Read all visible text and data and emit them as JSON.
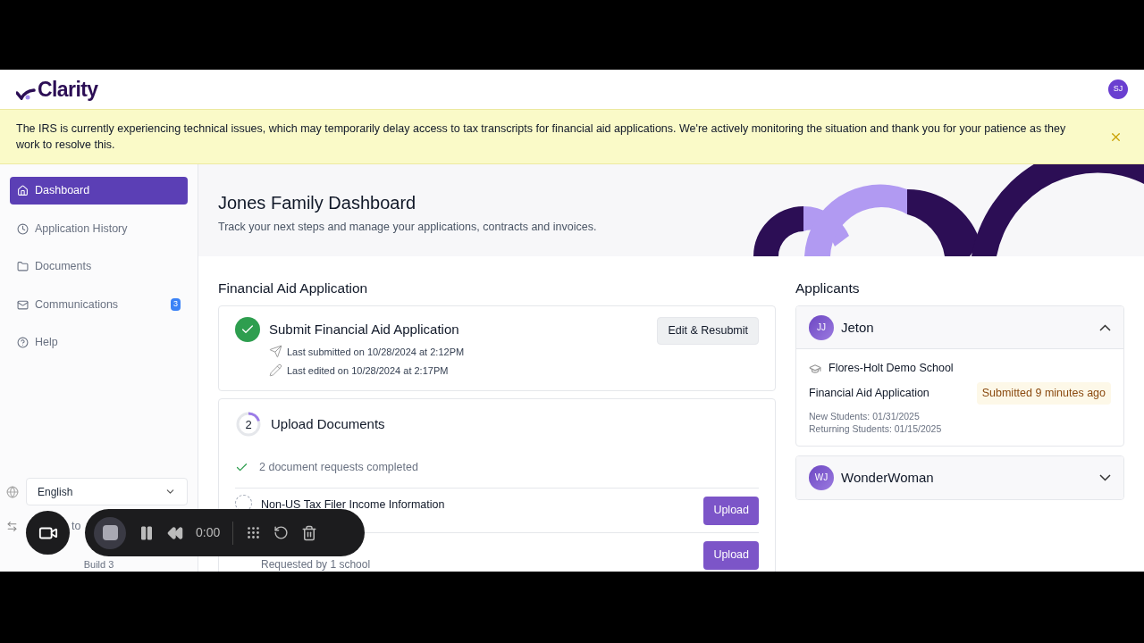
{
  "logo": {
    "text": "Clarity"
  },
  "user": {
    "initials": "SJ"
  },
  "banner": {
    "message": "The IRS is currently experiencing technical issues, which may temporarily delay access to tax transcripts for financial aid applications. We're actively monitoring the situation and thank you for your patience as they work to resolve this."
  },
  "sidebar": {
    "items": [
      {
        "label": "Dashboard",
        "selected": true
      },
      {
        "label": "Application History",
        "selected": false
      },
      {
        "label": "Documents",
        "selected": false
      },
      {
        "label": "Communications",
        "selected": false,
        "badge": "3"
      },
      {
        "label": "Help",
        "selected": false
      }
    ],
    "language": "English",
    "switch_link": "to",
    "build": "Build 3"
  },
  "hero": {
    "title": "Jones Family Dashboard",
    "subtitle": "Track your next steps and manage your applications, contracts and invoices."
  },
  "financial_aid": {
    "heading": "Financial Aid Application",
    "steps": [
      {
        "kind": "complete",
        "title": "Submit Financial Aid Application",
        "details": [
          "Last submitted on 10/28/2024 at 2:12PM",
          "Last edited on 10/28/2024 at 2:17PM"
        ],
        "button": "Edit & Resubmit"
      },
      {
        "kind": "progress",
        "number": "2",
        "level": 0.2,
        "title": "Upload Documents",
        "completed_note": "2 document requests completed",
        "requests": [
          {
            "title": "Non-US Tax Filer Income Information",
            "button": "Upload"
          },
          {
            "subtitle": "Requested by 1 school",
            "button": "Upload"
          }
        ]
      }
    ]
  },
  "applicants": {
    "heading": "Applicants",
    "items": [
      {
        "initials": "JJ",
        "name": "Jeton",
        "expanded": true,
        "school": "Flores-Holt Demo School",
        "application": "Financial Aid Application",
        "status": "Submitted 9 minutes ago",
        "deadlines": [
          "New Students: 01/31/2025",
          "Returning Students: 01/15/2025"
        ]
      },
      {
        "initials": "WJ",
        "name": "WonderWoman",
        "expanded": false
      }
    ]
  },
  "recorder": {
    "time": "0:00"
  }
}
